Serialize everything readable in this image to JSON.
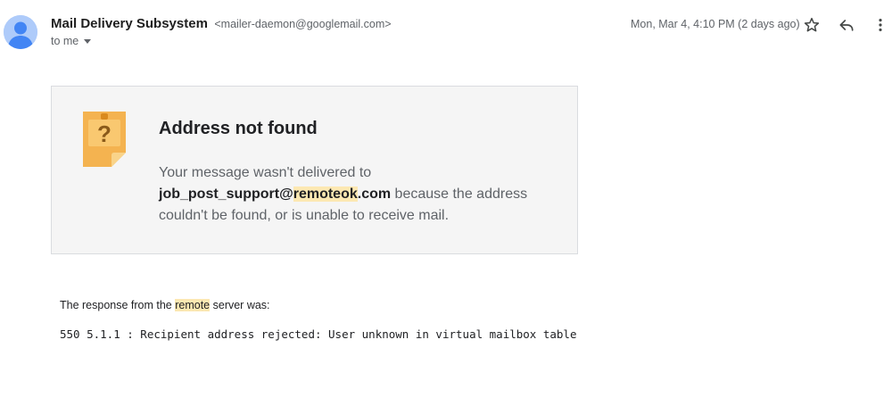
{
  "header": {
    "sender_name": "Mail Delivery Subsystem",
    "sender_email": "<mailer-daemon@googlemail.com>",
    "to_label": "to me",
    "date": "Mon, Mar 4, 4:10 PM (2 days ago)",
    "icons": [
      "avatar-person-icon",
      "star-icon",
      "reply-icon",
      "more-vert-icon"
    ]
  },
  "bounce": {
    "icon": "question-note-icon",
    "title": "Address not found",
    "body_prefix": "Your message wasn't delivered to",
    "address_user": "job_post_support@",
    "address_highlight": "remoteok",
    "address_suffix": ".com",
    "body_suffix": " because the address couldn't be found, or is unable to receive mail."
  },
  "response": {
    "label_prefix": "The response from the ",
    "label_highlight": "remote",
    "label_suffix": " server was:",
    "code": "550 5.1.1 : Recipient address rejected: User unknown in virtual mailbox table"
  },
  "colors": {
    "highlight": "#fce8b2",
    "card_background": "#f5f5f5",
    "note_orange": "#f4b350",
    "avatar": "#aecbfa"
  }
}
